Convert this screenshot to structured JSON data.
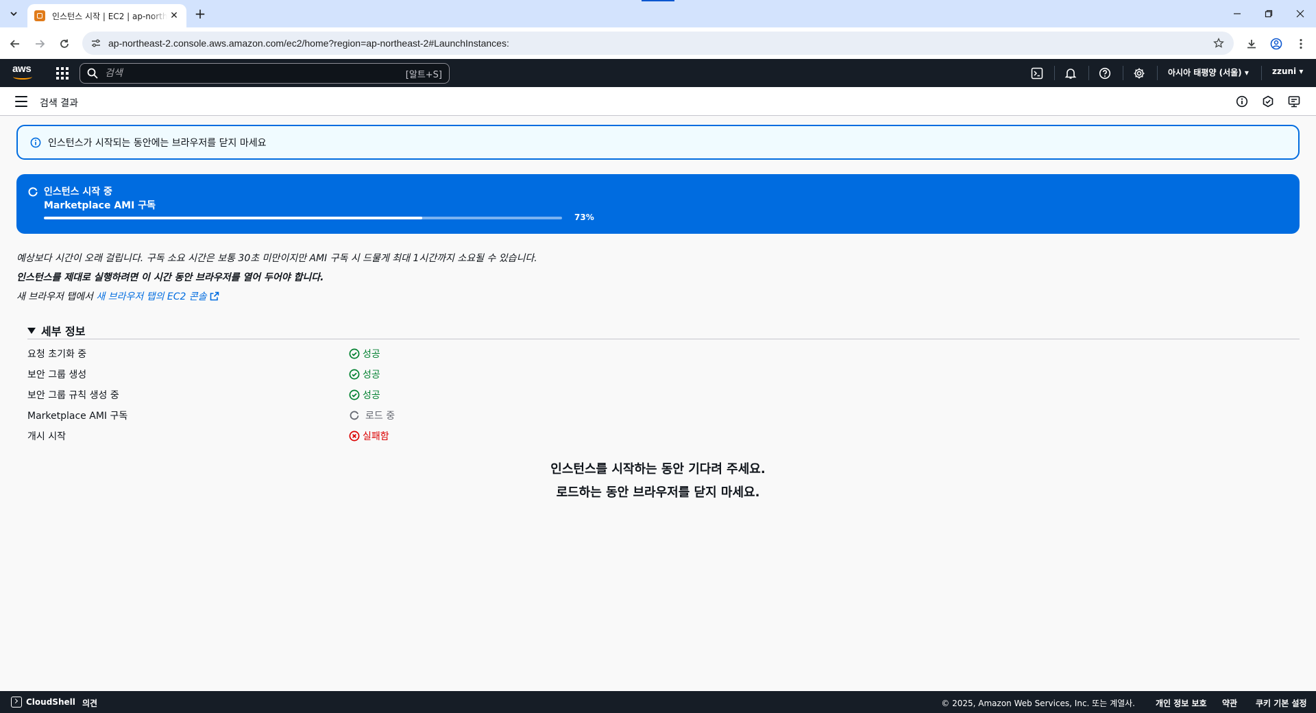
{
  "browser": {
    "tab_title": "인스턴스 시작 | EC2 | ap-northeast-2",
    "url": "ap-northeast-2.console.aws.amazon.com/ec2/home?region=ap-northeast-2#LaunchInstances:"
  },
  "aws_nav": {
    "logo": "aws",
    "search_placeholder": "검색",
    "search_shortcut": "[알트+S]",
    "region": "아시아 태평양 (서울) ▾",
    "user": "zzuni ▾"
  },
  "breadcrumb": {
    "label": "검색 결과"
  },
  "info_alert": {
    "text": "인스턴스가 시작되는 동안에는 브라우저를 닫지 마세요"
  },
  "progress_flash": {
    "title": "인스턴스 시작 중",
    "subtitle": "Marketplace AMI 구독",
    "progress_percent": 73,
    "progress_label": "73%",
    "background_color": "#006ce0"
  },
  "notes": {
    "line1": "예상보다 시간이 오래 걸립니다. 구독 소요 시간은 보통 30초 미만이지만 AMI 구독 시 드물게 최대 1시간까지 소요될 수 있습니다.",
    "line2": "인스턴스를 제대로 실행하려면 이 시간 동안 브라우저를 열어 두어야 합니다.",
    "line3_prefix": "새 브라우저 탭에서 ",
    "line3_link": "새 브라우저 탭의 EC2 콘솔"
  },
  "details": {
    "heading": "세부 정보",
    "steps": [
      {
        "label": "요청 초기화 중",
        "status": "성공",
        "state": "success"
      },
      {
        "label": "보안 그룹 생성",
        "status": "성공",
        "state": "success"
      },
      {
        "label": "보안 그룹 규칙 생성 중",
        "status": "성공",
        "state": "success"
      },
      {
        "label": "Marketplace AMI 구독",
        "status": "로드 중",
        "state": "loading"
      },
      {
        "label": "개시 시작",
        "status": "실패함",
        "state": "failed"
      }
    ]
  },
  "wait_message": {
    "line1": "인스턴스를 시작하는 동안 기다려 주세요.",
    "line2": "로드하는 동안 브라우저를 닫지 마세요."
  },
  "footer": {
    "cloudshell": "CloudShell",
    "feedback": "의견",
    "copyright": "© 2025, Amazon Web Services, Inc. 또는 계열사.",
    "privacy": "개인 정보 보호",
    "terms": "약관",
    "cookies": "쿠키 기본 설정"
  },
  "colors": {
    "accent": "#006ce0",
    "success": "#00802f",
    "error": "#db0000",
    "nav_bg": "#161d26"
  }
}
